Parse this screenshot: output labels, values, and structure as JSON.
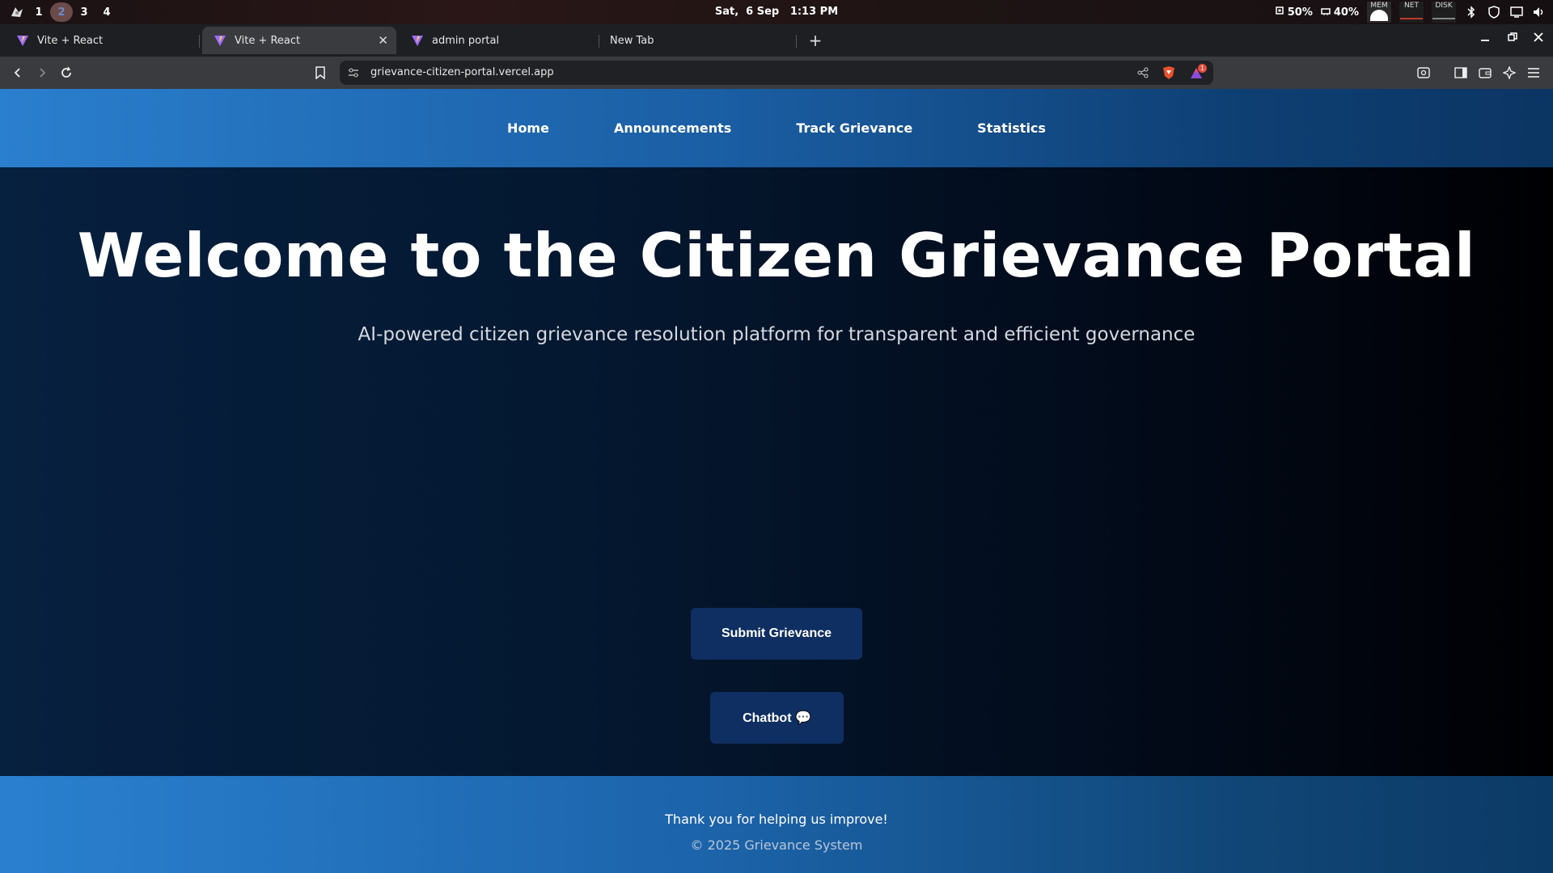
{
  "os": {
    "workspaces": [
      "1",
      "2",
      "3",
      "4"
    ],
    "active_workspace": "2",
    "clock": "Sat,  6 Sep   1:13 PM",
    "cpu": "50%",
    "ram": "40%",
    "monitors": [
      "MEM",
      "NET",
      "DISK"
    ]
  },
  "browser": {
    "tabs": [
      {
        "title": "Vite + React"
      },
      {
        "title": "Vite + React"
      },
      {
        "title": "admin portal"
      },
      {
        "title": "New Tab"
      }
    ],
    "url": "grievance-citizen-portal.vercel.app",
    "alert_count": "1"
  },
  "site": {
    "nav": [
      "Home",
      "Announcements",
      "Track Grievance",
      "Statistics"
    ],
    "hero": {
      "title": "Welcome to the Citizen Grievance Portal",
      "subtitle": "AI-powered citizen grievance resolution platform for transparent and efficient governance"
    },
    "buttons": {
      "submit": "Submit Grievance",
      "chatbot": "Chatbot 💬"
    },
    "footer": {
      "thanks": "Thank you for helping us improve!",
      "copyright": "© 2025 Grievance System"
    }
  },
  "colors": {
    "nav_gradient_start": "#2a7fce",
    "hero_bg": "#04172f",
    "button_bg": "#0f2f62"
  }
}
